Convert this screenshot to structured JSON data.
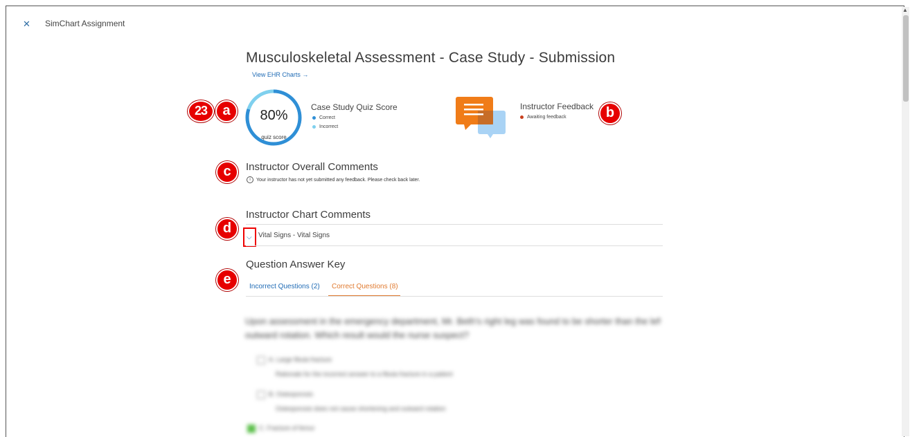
{
  "header": {
    "close_icon": "close-icon",
    "app_title": "SimChart Assignment"
  },
  "page": {
    "title": "Musculoskeletal Assessment - Case Study - Submission",
    "ehr_link": "View EHR Charts →"
  },
  "score": {
    "value": "80%",
    "caption": "quiz score",
    "fraction": 0.8
  },
  "quiz_card": {
    "title": "Case Study Quiz Score",
    "legend": [
      {
        "label": "Correct",
        "color": "#2f8fd6"
      },
      {
        "label": "Incorrect",
        "color": "#7fd0ee"
      }
    ]
  },
  "feedback_card": {
    "title": "Instructor Feedback",
    "status": "Awaiting feedback",
    "status_color": "#c8401e",
    "icon": "chat-bubbles-icon"
  },
  "overall_comments": {
    "title": "Instructor Overall Comments",
    "info_glyph": "i",
    "message": "Your instructor has not yet submitted any feedback. Please check back later."
  },
  "chart_comments": {
    "title": "Instructor Chart Comments",
    "item": "Vital Signs - Vital Signs"
  },
  "answer_key": {
    "title": "Question Answer Key",
    "tabs": [
      {
        "label": "Incorrect Questions (2)",
        "active": false
      },
      {
        "label": "Correct Questions (8)",
        "active": true
      }
    ]
  },
  "annotations": {
    "step": "23",
    "a": "a",
    "b": "b",
    "c": "c",
    "d": "d",
    "e": "e"
  },
  "blurred": {
    "question_line1": "Upon assessment in the emergency department, Mr. Beth's right leg was found to be shorter than the left, with outward rotation. Which result would the nurse suspect?",
    "question_line2": "outward rotation. Which result would the nurse suspect?",
    "option1": "A. Large fibula fracture",
    "option1_sub": "Rationale for the incorrect answer to a fibula fracture in a patient",
    "option2": "B. Osteoporosis",
    "option2_sub": "Osteoporosis does not cause shortening and outward rotation",
    "option3": "C. Fracture of femur"
  }
}
